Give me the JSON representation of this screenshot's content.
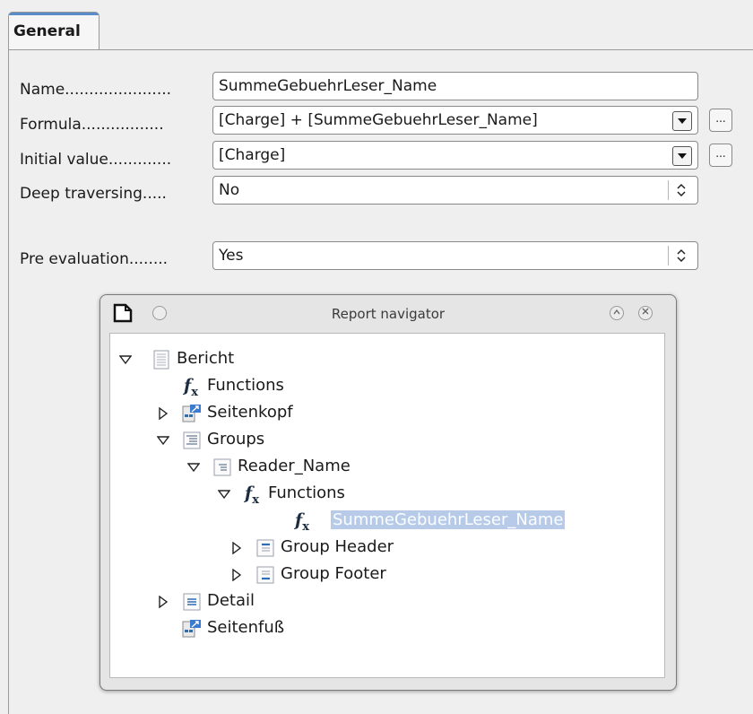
{
  "tabs": [
    {
      "label": "General"
    }
  ],
  "form": {
    "name": {
      "label": "Name......................",
      "value": "SummeGebuehrLeser_Name"
    },
    "formula": {
      "label": "Formula.................",
      "value": "[Charge] + [SummeGebuehrLeser_Name]",
      "more": "..."
    },
    "initial": {
      "label": "Initial value.............",
      "value": "[Charge]",
      "more": "..."
    },
    "deep": {
      "label": "Deep traversing.....",
      "value": "No"
    },
    "pre": {
      "label": "Pre evaluation........",
      "value": "Yes"
    }
  },
  "navigator": {
    "title": "Report navigator",
    "tree": {
      "bericht": "Bericht",
      "functions_root": "Functions",
      "seitenkopf": "Seitenkopf",
      "groups": "Groups",
      "reader_name": "Reader_Name",
      "functions_group": "Functions",
      "summe": "SummeGebuehrLeser_Name",
      "group_header": "Group Header",
      "group_footer": "Group Footer",
      "detail": "Detail",
      "seitenfuss": "Seitenfuß"
    }
  },
  "colors": {
    "selection": "#b7cbe9",
    "tab_accent": "#5a8cc8",
    "icon_blue": "#2f6db5"
  }
}
